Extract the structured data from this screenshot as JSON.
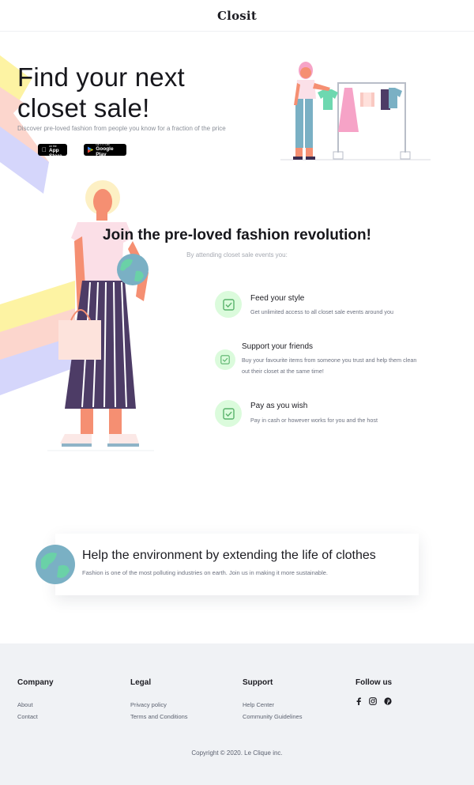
{
  "brand": {
    "logo": "Closit"
  },
  "hero": {
    "title_line1": "Find your next",
    "title_line2": "closet sale!",
    "subtitle": "Discover pre-loved fashion from people you know for a fraction of the price",
    "app_store": {
      "small": "Download on the",
      "big": "App Store"
    },
    "google_play": {
      "small": "GET IT ON",
      "big": "Google Play"
    }
  },
  "join": {
    "title": "Join the pre-loved fashion revolution!",
    "subtitle": "By attending closet sale events you:",
    "features": [
      {
        "title": "Feed your style",
        "text_line1": "Get unlimited access to all closet sale events around you",
        "text_line2": ""
      },
      {
        "title": "Support your friends",
        "text_line1": "Buy your favourite items from someone you trust and help them clean",
        "text_line2": "out their closet at the same time!"
      },
      {
        "title": "Pay as you wish",
        "text_line1": "Pay in cash or however works for you and the host",
        "text_line2": ""
      }
    ]
  },
  "environment": {
    "title": "Help the environment by extending the life of clothes",
    "text": "Fashion is one of the most polluting industries on earth. Join us in making it more sustainable."
  },
  "footer": {
    "company": {
      "heading": "Company",
      "links": [
        "About",
        "Contact"
      ]
    },
    "legal": {
      "heading": "Legal",
      "links": [
        "Privacy policy",
        "Terms and Conditions"
      ]
    },
    "support": {
      "heading": "Support",
      "links": [
        "Help Center",
        "Community Guidelines"
      ]
    },
    "follow": {
      "heading": "Follow us",
      "icons": [
        "facebook-icon",
        "instagram-icon",
        "pinterest-icon"
      ]
    },
    "copyright": "Copyright © 2020. Le Clique inc."
  },
  "colors": {
    "stripe_yellow": "#fdf3a3",
    "stripe_pink": "#fcd6cd",
    "stripe_lavender": "#d5d6fb",
    "check_bg": "#dbfbdc",
    "check_green": "#59b36b",
    "footer_bg": "#f0f2f5"
  }
}
